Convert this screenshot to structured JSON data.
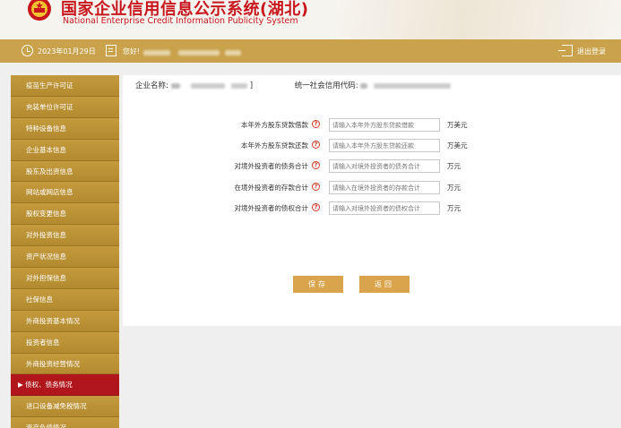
{
  "header": {
    "title_cn": "国家企业信用信息公示系统(湖北)",
    "title_en": "National Enterprise Credit Information Publicity System"
  },
  "topbar": {
    "date": "2023年01月29日",
    "greeting": "您好!",
    "logout": "退出登录"
  },
  "sidebar": {
    "items": [
      {
        "label": "疫苗生产许可证"
      },
      {
        "label": "充装单位许可证"
      },
      {
        "label": "特种设备信息"
      },
      {
        "label": "企业基本信息"
      },
      {
        "label": "股东及出资信息"
      },
      {
        "label": "网站或网店信息"
      },
      {
        "label": "股权变更信息"
      },
      {
        "label": "对外投资信息"
      },
      {
        "label": "资产状况信息"
      },
      {
        "label": "对外担保信息"
      },
      {
        "label": "社保信息"
      },
      {
        "label": "外商投资基本情况"
      },
      {
        "label": "投资者信息"
      },
      {
        "label": "外商投资经营情况"
      },
      {
        "label": "▶ 债权、债务情况"
      },
      {
        "label": "进口设备减免税情况"
      },
      {
        "label": "资产负债情况"
      }
    ],
    "active_index": 14
  },
  "company": {
    "name_label": "企业名称:",
    "name_value_tail": "]",
    "code_label": "统一社会信用代码:"
  },
  "form": {
    "rows": [
      {
        "label": "本年外方股东贷款借款",
        "placeholder": "请输入本年外方股东贷款借款",
        "unit": "万美元"
      },
      {
        "label": "本年外方股东贷款还款",
        "placeholder": "请输入本年外方股东贷款还款",
        "unit": "万美元"
      },
      {
        "label": "对境外投资者的债务合计",
        "placeholder": "请输入对境外投资者的债务合计",
        "unit": "万元"
      },
      {
        "label": "在境外投资者的存款合计",
        "placeholder": "请输入在境外投资者的存款合计",
        "unit": "万元"
      },
      {
        "label": "对境外投资者的债权合计",
        "placeholder": "请输入对境外投资者的债权合计",
        "unit": "万元"
      }
    ],
    "help_glyph": "?"
  },
  "buttons": {
    "save": "保存",
    "back": "返回"
  },
  "colors": {
    "brand_red": "#c8161d",
    "gold": "#c9a24b",
    "active_red": "#b0161b",
    "button_gold": "#d9a44c"
  }
}
